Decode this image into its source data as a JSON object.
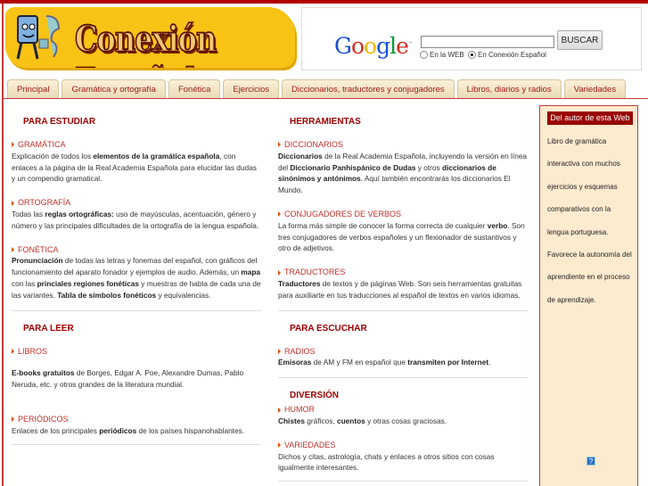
{
  "logo": {
    "title": "Conexión Español"
  },
  "search": {
    "google": "Google",
    "button": "BUSCAR",
    "value": "",
    "opt_web": "En la WEB",
    "opt_site": "En Conexión Español"
  },
  "tabs": [
    "Principal",
    "Gramática y ortografía",
    "Fonética",
    "Ejercicios",
    "Diccionarios, traductores y conjugadores",
    "Libros, diarios y radios",
    "Variedades"
  ],
  "left": [
    {
      "heading": "PARA ESTUDIAR",
      "items": [
        {
          "link": "GRAMÁTICA",
          "text": [
            {
              "t": "Explicación de todos los "
            },
            {
              "t": "elementos de la gramática española",
              "b": true
            },
            {
              "t": ", con enlaces a la página de la Real Academia Española para elucidar las dudas y un compendio gramatical."
            }
          ]
        },
        {
          "link": "ORTOGRAFÍA",
          "text": [
            {
              "t": "Todas las "
            },
            {
              "t": "reglas ortográficas:",
              "b": true
            },
            {
              "t": " uso de mayúsculas, acentuación, género y número y las principales dificultades de la ortografía de la lengua española."
            }
          ]
        },
        {
          "link": "FONÉTICA",
          "text": [
            {
              "t": "Pronunciación",
              "b": true
            },
            {
              "t": " de todas las letras y fonemas del español, con gráficos del funcionamiento del aparato fonador y ejemplos de audio. Además, un "
            },
            {
              "t": "mapa",
              "b": true
            },
            {
              "t": " con las "
            },
            {
              "t": "princiales regiones fonéticas",
              "b": true
            },
            {
              "t": " y muestras de habla de cada una de las variantes. "
            },
            {
              "t": "Tabla de símbolos fonéticos",
              "b": true
            },
            {
              "t": " y equivalencias."
            }
          ]
        }
      ]
    },
    {
      "heading": "PARA LEER",
      "items": [
        {
          "link": "LIBROS",
          "text": [
            {
              "t": "E-books gratuitos",
              "b": true
            },
            {
              "t": " de Borges, Edgar A. Poe, Alexandre Dumas, Pablo Neruda, etc. y otros grandes de la literatura mundial."
            }
          ]
        },
        {
          "link": "PERIÓDICOS",
          "text": [
            {
              "t": "Enlaces de los principales "
            },
            {
              "t": "periódicos",
              "b": true
            },
            {
              "t": " de los países hispanohablantes."
            }
          ]
        }
      ]
    }
  ],
  "right": [
    {
      "heading": "HERRAMIENTAS",
      "items": [
        {
          "link": "DICCIONARIOS",
          "text": [
            {
              "t": "Diccionarios",
              "b": true
            },
            {
              "t": " de la Real Academia Española, incluyendo la versión en línea del "
            },
            {
              "t": "Diccionario Panhispánico de Dudas",
              "b": true
            },
            {
              "t": " y otros "
            },
            {
              "t": "diccionarios de sinónimos y antónimos",
              "b": true
            },
            {
              "t": ". Aquí también encontrarás los diccionarios El Mundo."
            }
          ]
        },
        {
          "link": "CONJUGADORES DE VERBOS",
          "text": [
            {
              "t": "La forma más simple de conocer la forma correcta de cualquier "
            },
            {
              "t": "verbo",
              "b": true
            },
            {
              "t": ". Son tres conjugadores de verbos españoles y un flexionador de sustantivos y otro de adjetivos."
            }
          ]
        },
        {
          "link": "TRADUCTORES",
          "text": [
            {
              "t": "Traductores",
              "b": true
            },
            {
              "t": " de textos y de páginas Web. Son seis herramientas gratuitas para auxiliarte en tus traducciones al español de textos en varios idiomas."
            }
          ]
        }
      ]
    },
    {
      "heading": "PARA ESCUCHAR",
      "items": [
        {
          "link": "RADIOS",
          "text": [
            {
              "t": "Emisoras",
              "b": true
            },
            {
              "t": " de AM y FM en español que "
            },
            {
              "t": "transmiten por Internet",
              "b": true
            },
            {
              "t": "."
            }
          ]
        }
      ]
    },
    {
      "heading": "DIVERSIÓN",
      "items": [
        {
          "link": "HUMOR",
          "text": [
            {
              "t": "Chistes",
              "b": true
            },
            {
              "t": " gráficos, "
            },
            {
              "t": "cuentos",
              "b": true
            },
            {
              "t": " y otras cosas graciosas."
            }
          ]
        },
        {
          "link": "VARIEDADES",
          "text": [
            {
              "t": "Dichos y citas, astrología, chats y enlaces a otros sitios con cosas igualmente interesantes."
            }
          ]
        }
      ]
    }
  ],
  "sidebar": {
    "heading": "Del autor de esta Web",
    "text": "Libro de gramática interactiva con muchos ejercicios  y esquemas comparativos con la lengua portuguesa. Favorece la autonomía del aprendiente en el proceso de aprendizaje.",
    "help": "?"
  },
  "colors": {
    "accent": "#a00000",
    "tab_text": "#a01818",
    "sidebar_bg": "#fdebd0"
  }
}
